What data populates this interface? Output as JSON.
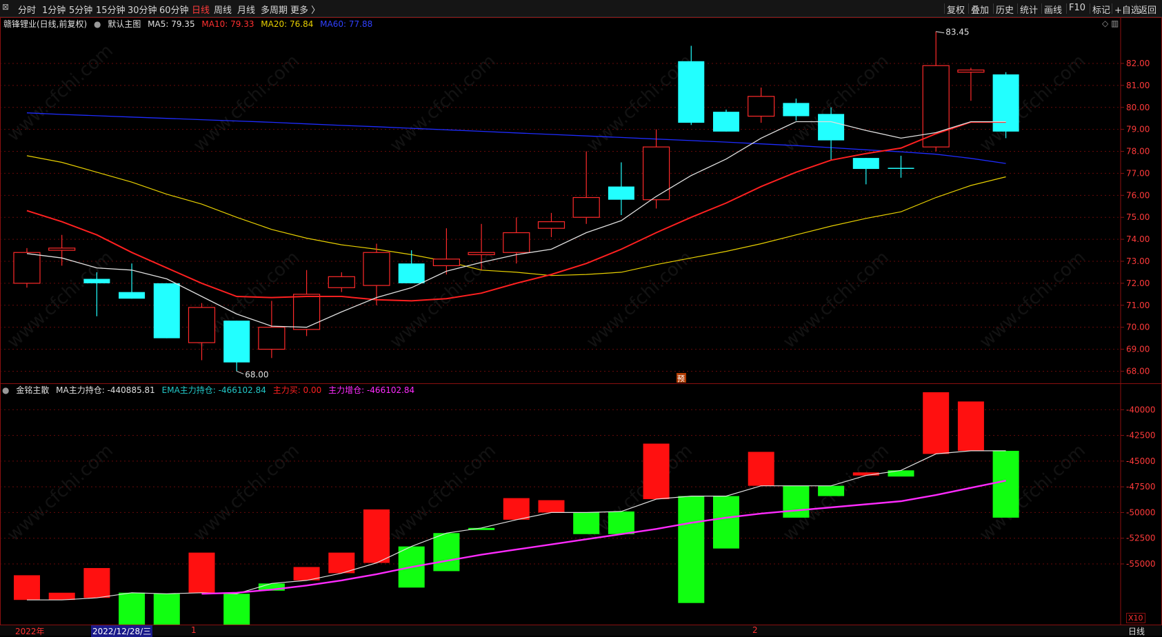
{
  "toolbar": {
    "left": [
      {
        "label": "分时"
      },
      {
        "label": "1分钟"
      },
      {
        "label": "5分钟"
      },
      {
        "label": "15分钟"
      },
      {
        "label": "30分钟"
      },
      {
        "label": "60分钟"
      },
      {
        "label": "日线",
        "active": true
      },
      {
        "label": "周线"
      },
      {
        "label": "月线"
      },
      {
        "label": "多周期"
      },
      {
        "label": "更多 〉"
      }
    ],
    "right": [
      {
        "label": "复权"
      },
      {
        "label": "叠加"
      },
      {
        "label": "历史"
      },
      {
        "label": "统计"
      },
      {
        "label": "画线"
      },
      {
        "label": "F10"
      },
      {
        "label": "标记"
      },
      {
        "label": "+自选"
      },
      {
        "label": "返回"
      }
    ]
  },
  "main_info": {
    "stock": "赣锋锂业(日线,前复权)",
    "indicator": "默认主图",
    "ma5": "MA5: 79.35",
    "ma10": "MA10: 79.33",
    "ma20": "MA20: 76.84",
    "ma60": "MA60: 77.88"
  },
  "sub_info": {
    "indicator": "金铭主散",
    "ma": "MA主力持仓: -440885.81",
    "ema": "EMA主力持仓: -466102.84",
    "buy": "主力买: 0.00",
    "add": "主力增仓: -466102.84"
  },
  "colors": {
    "up": "#ff2a2a",
    "down": "#22ffff",
    "ma5": "#e0e0e0",
    "ma10": "#ff2020",
    "ma20": "#e8d000",
    "ma60": "#1e2cff",
    "bar_up": "#ff1010",
    "bar_down": "#11ff11",
    "ema": "#ff2bff"
  },
  "chart_data": [
    {
      "type": "candlestick",
      "name": "main",
      "ylim": [
        67.45,
        84.1
      ],
      "yticks": [
        "68.00",
        "69.00",
        "70.00",
        "71.00",
        "72.00",
        "73.00",
        "74.00",
        "75.00",
        "76.00",
        "77.00",
        "78.00",
        "79.00",
        "80.00",
        "81.00",
        "82.00"
      ],
      "high_label": "83.45",
      "low_label": "68.00",
      "pre_label": "预",
      "candles": [
        {
          "o": 72.0,
          "c": 73.4,
          "h": 73.6,
          "l": 71.8
        },
        {
          "o": 73.5,
          "c": 73.6,
          "h": 74.2,
          "l": 72.8
        },
        {
          "o": 72.2,
          "c": 72.0,
          "h": 72.5,
          "l": 70.5
        },
        {
          "o": 71.6,
          "c": 71.3,
          "h": 72.9,
          "l": 71.3
        },
        {
          "o": 72.0,
          "c": 69.5,
          "h": 72.0,
          "l": 69.5
        },
        {
          "o": 69.3,
          "c": 70.9,
          "h": 71.1,
          "l": 68.5
        },
        {
          "o": 70.3,
          "c": 68.4,
          "h": 70.3,
          "l": 68.0
        },
        {
          "o": 69.0,
          "c": 70.0,
          "h": 71.2,
          "l": 68.6
        },
        {
          "o": 69.9,
          "c": 71.5,
          "h": 72.6,
          "l": 69.6
        },
        {
          "o": 71.8,
          "c": 72.3,
          "h": 72.5,
          "l": 71.6
        },
        {
          "o": 71.9,
          "c": 73.4,
          "h": 73.8,
          "l": 71.0
        },
        {
          "o": 72.9,
          "c": 72.0,
          "h": 73.5,
          "l": 72.0
        },
        {
          "o": 72.8,
          "c": 73.1,
          "h": 74.5,
          "l": 72.4
        },
        {
          "o": 73.3,
          "c": 73.4,
          "h": 74.7,
          "l": 72.6
        },
        {
          "o": 73.4,
          "c": 74.3,
          "h": 75.0,
          "l": 72.9
        },
        {
          "o": 74.5,
          "c": 74.8,
          "h": 75.2,
          "l": 74.1
        },
        {
          "o": 75.0,
          "c": 75.9,
          "h": 78.0,
          "l": 74.7
        },
        {
          "o": 76.4,
          "c": 75.8,
          "h": 77.5,
          "l": 75.1
        },
        {
          "o": 75.8,
          "c": 78.2,
          "h": 79.0,
          "l": 75.4
        },
        {
          "o": 82.1,
          "c": 79.3,
          "h": 82.8,
          "l": 79.2
        },
        {
          "o": 79.8,
          "c": 78.9,
          "h": 79.9,
          "l": 78.9
        },
        {
          "o": 79.6,
          "c": 80.5,
          "h": 80.9,
          "l": 79.3
        },
        {
          "o": 80.2,
          "c": 79.6,
          "h": 80.4,
          "l": 79.4
        },
        {
          "o": 79.7,
          "c": 78.5,
          "h": 80.0,
          "l": 77.6
        },
        {
          "o": 77.7,
          "c": 77.2,
          "h": 77.7,
          "l": 76.5
        },
        {
          "o": 77.25,
          "c": 77.25,
          "h": 77.8,
          "l": 76.8
        },
        {
          "o": 78.2,
          "c": 81.9,
          "h": 83.45,
          "l": 78.0
        },
        {
          "o": 81.6,
          "c": 81.7,
          "h": 81.8,
          "l": 80.3
        },
        {
          "o": 81.5,
          "c": 78.9,
          "h": 81.6,
          "l": 78.6
        }
      ],
      "ma5": [
        73.35,
        73.15,
        72.7,
        72.6,
        72.2,
        71.4,
        70.6,
        70.05,
        70.0,
        70.7,
        71.35,
        71.8,
        72.55,
        72.95,
        73.3,
        73.55,
        74.3,
        74.85,
        75.95,
        76.9,
        77.65,
        78.6,
        79.35,
        79.35,
        78.95,
        78.6,
        78.85,
        79.35,
        79.35
      ],
      "ma10": [
        75.3,
        74.8,
        74.2,
        73.4,
        72.7,
        72.0,
        71.4,
        71.35,
        71.4,
        71.4,
        71.25,
        71.2,
        71.3,
        71.55,
        72.0,
        72.4,
        72.9,
        73.55,
        74.3,
        75.0,
        75.65,
        76.4,
        77.05,
        77.6,
        77.9,
        78.15,
        78.8,
        79.33,
        79.33
      ],
      "ma20": [
        77.8,
        77.5,
        77.05,
        76.6,
        76.05,
        75.6,
        75.0,
        74.45,
        74.05,
        73.75,
        73.55,
        73.3,
        73.0,
        72.6,
        72.5,
        72.35,
        72.4,
        72.5,
        72.85,
        73.15,
        73.45,
        73.8,
        74.2,
        74.6,
        74.95,
        75.25,
        75.9,
        76.45,
        76.84
      ],
      "ma60": [
        79.75,
        79.68,
        79.62,
        79.56,
        79.5,
        79.44,
        79.38,
        79.32,
        79.25,
        79.18,
        79.12,
        79.05,
        78.98,
        78.91,
        78.84,
        78.77,
        78.7,
        78.63,
        78.56,
        78.49,
        78.42,
        78.34,
        78.26,
        78.17,
        78.07,
        77.98,
        77.87,
        77.68,
        77.45
      ]
    },
    {
      "type": "bar",
      "name": "sub",
      "ylim": [
        -60900,
        -37500
      ],
      "yticks": [
        "-40000",
        "-42500",
        "-45000",
        "-47500",
        "-50000",
        "-52500",
        "-55000"
      ],
      "bars": [
        {
          "from": -58500,
          "to": -56100
        },
        {
          "from": -58500,
          "to": -57800
        },
        {
          "from": -58300,
          "to": -55400
        },
        {
          "from": -57800,
          "to": -61100
        },
        {
          "from": -57900,
          "to": -63400
        },
        {
          "from": -57800,
          "to": -53900
        },
        {
          "from": -57900,
          "to": -61600
        },
        {
          "from": -56900,
          "to": -57600
        },
        {
          "from": -56600,
          "to": -55300
        },
        {
          "from": -55900,
          "to": -53900
        },
        {
          "from": -54900,
          "to": -49700
        },
        {
          "from": -53300,
          "to": -57300
        },
        {
          "from": -52000,
          "to": -55700
        },
        {
          "from": -51500,
          "to": -51700
        },
        {
          "from": -50700,
          "to": -48600
        },
        {
          "from": -50000,
          "to": -48800
        },
        {
          "from": -50000,
          "to": -52100
        },
        {
          "from": -49900,
          "to": -52100
        },
        {
          "from": -48700,
          "to": -43300
        },
        {
          "from": -48400,
          "to": -58800
        },
        {
          "from": -48400,
          "to": -53500
        },
        {
          "from": -47400,
          "to": -44100
        },
        {
          "from": -47400,
          "to": -50500
        },
        {
          "from": -47400,
          "to": -48400
        },
        {
          "from": -46400,
          "to": -46100
        },
        {
          "from": -45900,
          "to": -46500
        },
        {
          "from": -44300,
          "to": -38300
        },
        {
          "from": -44000,
          "to": -39200
        },
        {
          "from": -44000,
          "to": -50500
        }
      ],
      "ma_line": [
        -58500,
        -58500,
        -58300,
        -57800,
        -57900,
        -57800,
        -57900,
        -56900,
        -56600,
        -55900,
        -54900,
        -53300,
        -52000,
        -51500,
        -50700,
        -50000,
        -50000,
        -49900,
        -48700,
        -48400,
        -48400,
        -47400,
        -47400,
        -47400,
        -46400,
        -45900,
        -44300,
        -44000,
        -44000
      ],
      "ema_line": [
        null,
        null,
        null,
        null,
        null,
        -57900,
        -57800,
        -57500,
        -57100,
        -56600,
        -56000,
        -55300,
        -54700,
        -54100,
        -53600,
        -53100,
        -52600,
        -52100,
        -51600,
        -51000,
        -50500,
        -50100,
        -49800,
        -49500,
        -49200,
        -48900,
        -48300,
        -47600,
        -46900
      ]
    }
  ],
  "dates": {
    "year_label": "2022年",
    "cursor_label": "2022/12/28/三",
    "month1": "1",
    "month2": "2"
  },
  "side": {
    "period_label": "日线",
    "zoom_label": "X10"
  },
  "watermark": "www.cfchi.com"
}
